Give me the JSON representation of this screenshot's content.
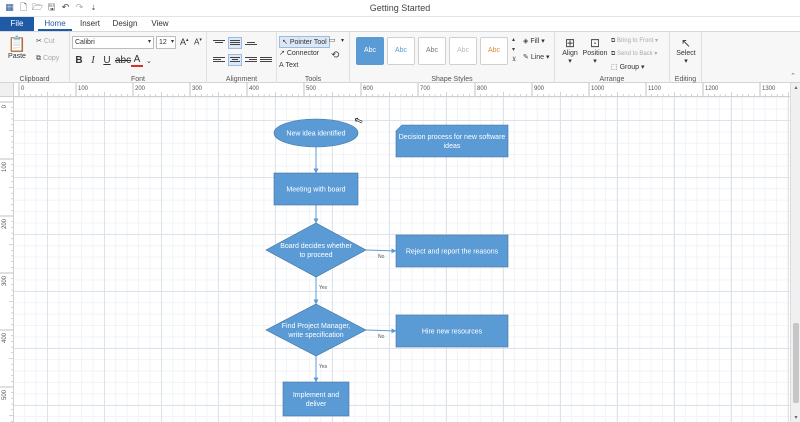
{
  "window": {
    "title": "Getting Started"
  },
  "qat": {
    "icons": [
      "app-logo-icon",
      "new-icon",
      "open-icon",
      "save-icon",
      "undo-icon",
      "redo-icon",
      "customize-icon"
    ]
  },
  "tabs": {
    "file": "File",
    "home": "Home",
    "insert": "Insert",
    "design": "Design",
    "view": "View"
  },
  "ribbon": {
    "clipboard": {
      "label": "Clipboard",
      "paste": "Paste",
      "cut": "Cut",
      "copy": "Copy"
    },
    "font": {
      "label": "Font",
      "name": "Calibri",
      "size": "12"
    },
    "alignment": {
      "label": "Alignment"
    },
    "tools": {
      "label": "Tools",
      "pointer": "Pointer Tool",
      "connector": "Connector",
      "text": "Text"
    },
    "styles": {
      "label": "Shape Styles",
      "swatch_text": "Abc",
      "fill": "Fill",
      "line": "Line"
    },
    "arrange": {
      "label": "Arrange",
      "align": "Align",
      "position": "Position",
      "bring_forward": "Bring to Front",
      "send_backward": "Send to Back",
      "group": "Group"
    },
    "editing": {
      "label": "Editing",
      "select": "Select"
    }
  },
  "colors": {
    "accent": "#1f5aa6",
    "shape_fill": "#5b9bd5",
    "shape_stroke": "#41719c",
    "connector": "#5b9bd5"
  },
  "diagram": {
    "nodes": [
      {
        "id": "start",
        "shape": "ellipse",
        "lines": [
          "New idea identified"
        ]
      },
      {
        "id": "note",
        "shape": "card",
        "lines": [
          "Decision process for new software",
          "ideas"
        ]
      },
      {
        "id": "meeting",
        "shape": "rect",
        "lines": [
          "Meeting with board"
        ]
      },
      {
        "id": "decide",
        "shape": "diamond",
        "lines": [
          "Board decides whether",
          "to proceed"
        ]
      },
      {
        "id": "reject",
        "shape": "rect",
        "lines": [
          "Reject and report the reasons"
        ]
      },
      {
        "id": "findpm",
        "shape": "diamond",
        "lines": [
          "Find Project Manager,",
          "write specification"
        ]
      },
      {
        "id": "hire",
        "shape": "rect",
        "lines": [
          "Hire new resources"
        ]
      },
      {
        "id": "implement",
        "shape": "rect",
        "lines": [
          "Implement and",
          "deliver"
        ]
      }
    ],
    "edges": [
      {
        "from": "start",
        "to": "meeting",
        "label": ""
      },
      {
        "from": "meeting",
        "to": "decide",
        "label": ""
      },
      {
        "from": "decide",
        "to": "reject",
        "label": "No"
      },
      {
        "from": "decide",
        "to": "findpm",
        "label": "Yes"
      },
      {
        "from": "findpm",
        "to": "hire",
        "label": "No"
      },
      {
        "from": "findpm",
        "to": "implement",
        "label": "Yes"
      }
    ]
  },
  "rulers": {
    "top": [
      "0",
      "100",
      "200",
      "300",
      "400",
      "500",
      "600",
      "700",
      "800",
      "900",
      "1000",
      "1100",
      "1200",
      "1300"
    ],
    "left": [
      "0",
      "100",
      "200",
      "300",
      "400",
      "500"
    ]
  }
}
